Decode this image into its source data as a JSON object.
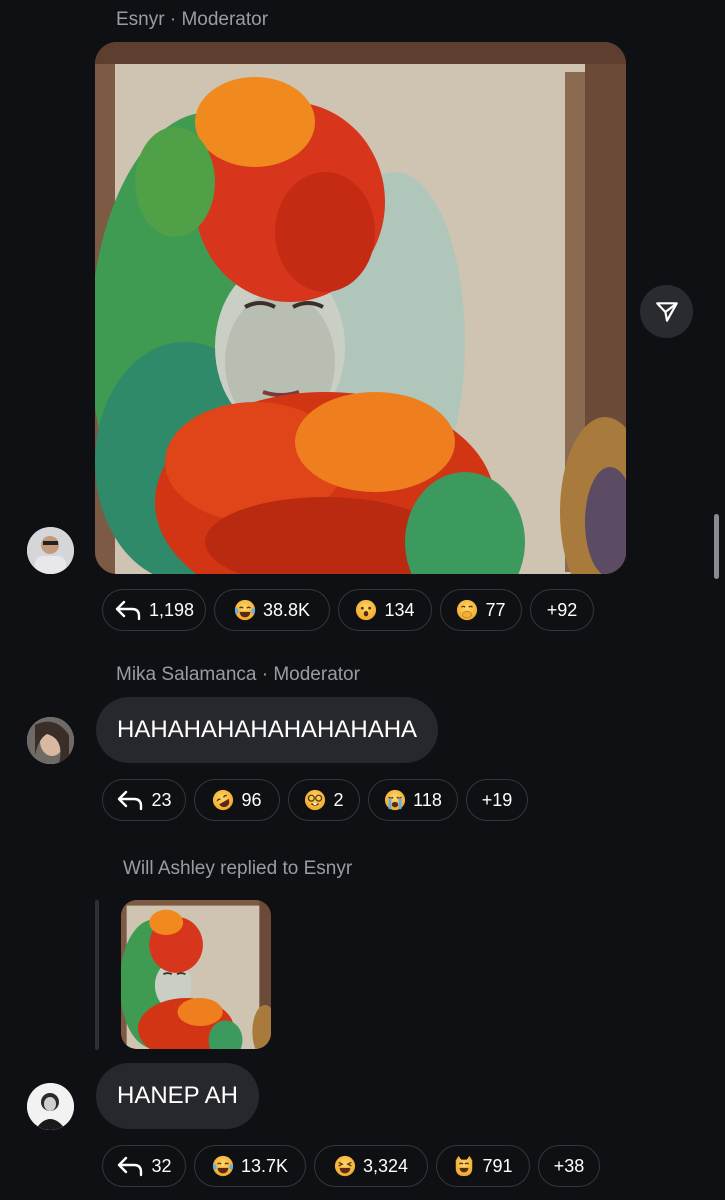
{
  "messages": [
    {
      "author": "Esnyr",
      "role": "Moderator",
      "author_line": "Esnyr · Moderator",
      "attachment": "feather-costume-photo",
      "reactions": [
        {
          "icon": "reply-icon",
          "count": "1,198"
        },
        {
          "icon": "tears-of-joy-emoji",
          "count": "38.8K"
        },
        {
          "icon": "astonished-emoji",
          "count": "134"
        },
        {
          "icon": "hand-over-mouth-emoji",
          "count": "77"
        },
        {
          "icon": "more",
          "count": "+92"
        }
      ]
    },
    {
      "author": "Mika Salamanca",
      "role": "Moderator",
      "author_line": "Mika Salamanca · Moderator",
      "text": "HAHAHAHAHAHAHAHAHA",
      "reactions": [
        {
          "icon": "reply-icon",
          "count": "23"
        },
        {
          "icon": "rofl-emoji",
          "count": "96"
        },
        {
          "icon": "nerd-emoji",
          "count": "2"
        },
        {
          "icon": "loudly-crying-emoji",
          "count": "118"
        },
        {
          "icon": "more",
          "count": "+19"
        }
      ]
    },
    {
      "author": "Will Ashley",
      "reply_label": "Will Ashley replied to Esnyr",
      "quoted_attachment": "feather-costume-photo-thumbnail",
      "text": "HANEP AH",
      "reactions": [
        {
          "icon": "reply-icon",
          "count": "32"
        },
        {
          "icon": "tears-of-joy-emoji",
          "count": "13.7K"
        },
        {
          "icon": "squinting-laugh-emoji",
          "count": "3,324"
        },
        {
          "icon": "grinning-cat-emoji",
          "count": "791"
        },
        {
          "icon": "more",
          "count": "+38"
        }
      ]
    }
  ],
  "share_button": {
    "icon": "paper-plane-icon"
  },
  "colors": {
    "background": "#0f1013",
    "bubble": "#27282d",
    "meta_text": "#9a9ca3",
    "pill_border": "#34363c",
    "emoji_yellow": "#f6c445"
  }
}
